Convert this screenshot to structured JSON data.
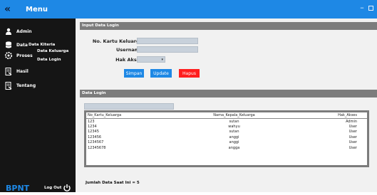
{
  "window": {
    "back_glyph": "«",
    "title": "Menu",
    "minimize_glyph": "–"
  },
  "sidebar": {
    "items": [
      {
        "label": "Admin",
        "icon": "user-icon"
      },
      {
        "label": "Data",
        "icon": "database-icon"
      },
      {
        "label": "Proses",
        "icon": "gears-icon"
      },
      {
        "label": "Hasil",
        "icon": "report-icon"
      },
      {
        "label": "Tentang",
        "icon": "info-icon"
      }
    ],
    "data_submenu": [
      "Data Kiteria"
    ],
    "proses_submenu": [
      "Data Keluarga",
      "Data Login"
    ],
    "brand": "BPNT",
    "logout_label": "Log Out"
  },
  "form": {
    "section_title": "Input Data Login",
    "fields": [
      {
        "label": "No. Kartu Keluarga",
        "value": ""
      },
      {
        "label": "Username",
        "value": ""
      },
      {
        "label": "Hak Akses",
        "value": ""
      }
    ],
    "buttons": {
      "save": "Simpan",
      "update": "Update",
      "delete": "Hapus"
    }
  },
  "table_section": {
    "title": "Data Login",
    "search_value": "",
    "columns": [
      "No_Kartu_Keluarga",
      "Nama_Kepala_Keluarga",
      "Hak_Akses"
    ],
    "rows": [
      [
        "123",
        "sutan",
        "Admin"
      ],
      [
        "1234",
        "wahyu",
        "User"
      ],
      [
        "12345",
        "sutan",
        "User"
      ],
      [
        "123456",
        "anggi",
        "User"
      ],
      [
        "1234567",
        "anggi",
        "User"
      ],
      [
        "12345678",
        "angga",
        "User"
      ]
    ],
    "count_label": "Jumlah Data Saat Ini = 5"
  },
  "colors": {
    "accent": "#1e88e5",
    "danger": "#ff1f1f",
    "sidebar": "#151515",
    "section_bar": "#7c7c7c"
  }
}
